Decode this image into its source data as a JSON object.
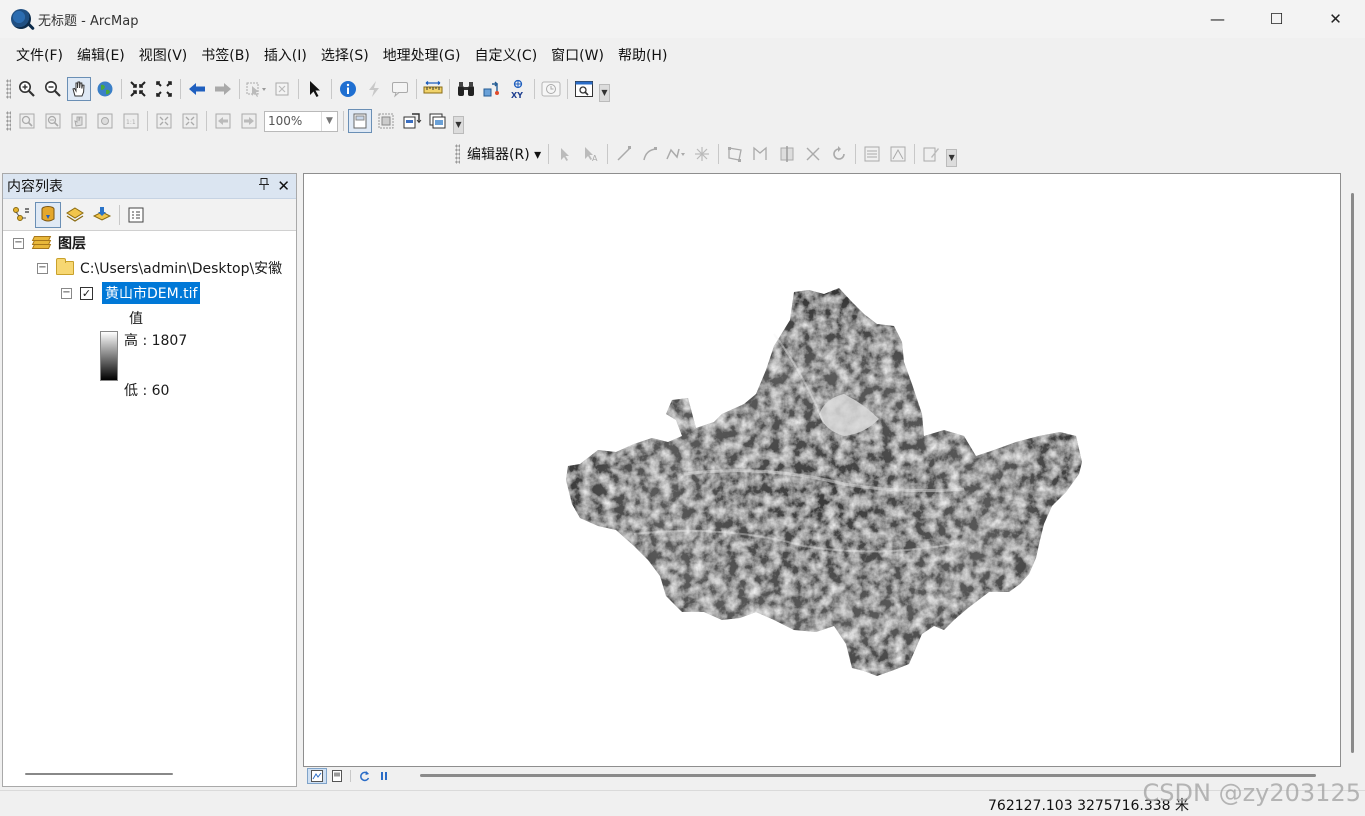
{
  "window": {
    "title": "无标题 - ArcMap",
    "controls": {
      "minimize": "—",
      "maximize": "☐",
      "close": "✕"
    }
  },
  "menu": [
    "文件(F)",
    "编辑(E)",
    "视图(V)",
    "书签(B)",
    "插入(I)",
    "选择(S)",
    "地理处理(G)",
    "自定义(C)",
    "窗口(W)",
    "帮助(H)"
  ],
  "toolbar_tools": {
    "zoom_in": "zoom-in-icon",
    "zoom_out": "zoom-out-icon",
    "pan": "pan-hand-icon",
    "full_extent": "globe-icon"
  },
  "layout_toolbar": {
    "zoom_value": "100%"
  },
  "editor_toolbar": {
    "label": "编辑器(R) ▾"
  },
  "toc": {
    "title": "内容列表",
    "pin_icon": "📌",
    "close_icon": "✕",
    "root_label": "图层",
    "folder_label": "C:\\Users\\admin\\Desktop\\安徽",
    "layer": {
      "name": "黄山市DEM.tif",
      "checked": true,
      "check_mark": "✓",
      "legend_title": "值",
      "high_label": "高 : 1807",
      "low_label": "低 : 60"
    },
    "collapse_glyph": "−"
  },
  "map": {
    "accent": "#0078d7"
  },
  "status": {
    "coordinates": "762127.103  3275716.338 米"
  },
  "watermark": "CSDN @zy203125"
}
